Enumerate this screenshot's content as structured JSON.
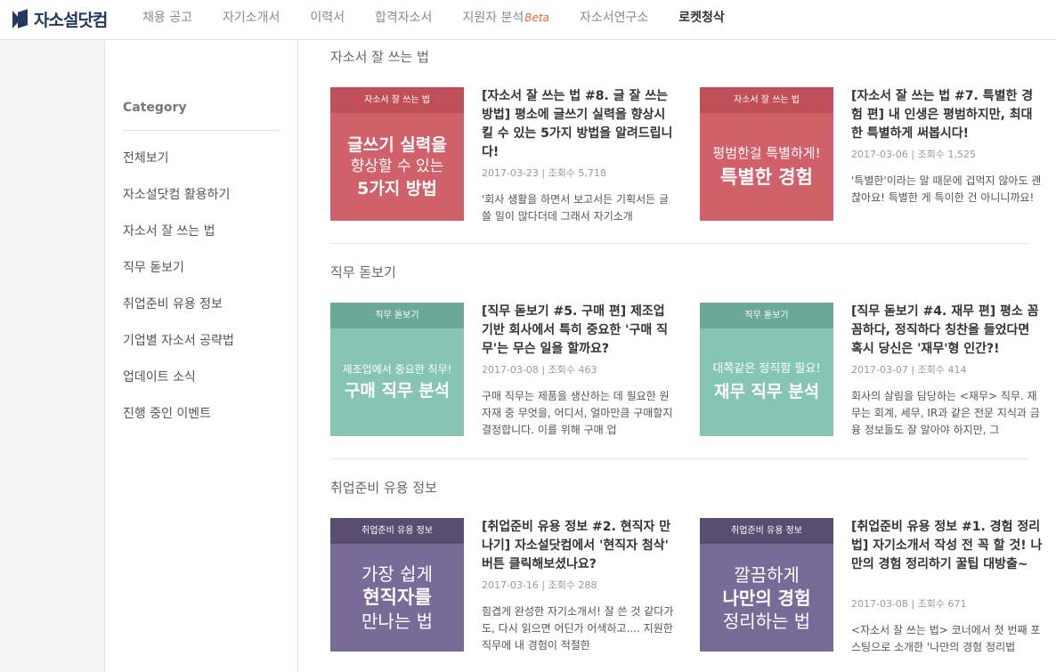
{
  "header": {
    "logo_text": "자소설닷컴",
    "nav": [
      {
        "label": "채용 공고"
      },
      {
        "label": "자기소개서"
      },
      {
        "label": "이력서"
      },
      {
        "label": "합격자소서"
      },
      {
        "label": "지원자 분석",
        "badge": "Beta"
      },
      {
        "label": "자소서연구소"
      },
      {
        "label": "로켓청삭"
      }
    ]
  },
  "sidebar": {
    "title": "Category",
    "items": [
      {
        "label": "전체보기"
      },
      {
        "label": "자소설닷컴 활용하기"
      },
      {
        "label": "자소서 잘 쓰는 법"
      },
      {
        "label": "직무 돋보기"
      },
      {
        "label": "취업준비 유용 정보"
      },
      {
        "label": "기업별 자소서 공략법"
      },
      {
        "label": "업데이트 소식"
      },
      {
        "label": "진행 중인 이벤트"
      }
    ]
  },
  "sections": [
    {
      "title": "자소서 잘 쓰는 법",
      "cards": [
        {
          "thumb_tag": "자소서 잘 쓰는 법",
          "thumb_lines": [
            "글쓰기 실력을",
            "향상할 수 있는",
            "5가지 방법"
          ],
          "title": "[자소서 잘 쓰는 법 #8. 글 잘 쓰는 방법] 평소에 글쓰기 실력을 향상시킬 수 있는 5가지 방법을 알려드립니다!",
          "meta": "2017-03-23 | 조회수 5,718",
          "desc": "'회사 생활을 하면서 보고서든 기획서든 글 쓸 일이 많다더데 그래서 자기소개"
        },
        {
          "thumb_tag": "자소서 잘 쓰는 법",
          "thumb_lines": [
            "평범한걸 특별하게!",
            "특별한 경험"
          ],
          "title": "[자소서 잘 쓰는 법 #7. 특별한 경험 편] 내 인생은 평범하지만, 최대한 특별하게 써봅시다!",
          "meta": "2017-03-06 | 조회수 1,525",
          "desc": "'특별한'이라는 말 때문에 겁먹지 않아도 괜찮아요! 특별한 게 특이한 건 아니니까요! 실패한 경험, 성취한 경험, 리더십"
        }
      ]
    },
    {
      "title": "직무 돋보기",
      "cards": [
        {
          "thumb_tag": "직무 돋보기",
          "thumb_lines": [
            "제조업에서 중요한 직무!",
            "구매 직무 분석"
          ],
          "title": "[직무 돋보기 #5. 구매 편] 제조업 기반 회사에서 특히 중요한 '구매 직무'는 무슨 일을 할까요?",
          "meta": "2017-03-08 | 조회수 463",
          "desc": "구매 직무는 제품을 생산하는 데 필요한 원자재 중 무엇을, 어디서, 얼마만큼 구매할지 결정합니다. 이를 위해 구매 업"
        },
        {
          "thumb_tag": "직무 돋보기",
          "thumb_lines": [
            "대쪽같은 정직함 필요!",
            "재무 직무 분석"
          ],
          "title": "[직무 돋보기 #4. 재무 편] 평소 꼼꼼하다, 정직하다 칭찬을 들었다면 혹시 당신은 '재무'형 인간?!",
          "meta": "2017-03-07 | 조회수 414",
          "desc": "회사의 살림을 담당하는 <재무> 직무. 재무는 회계, 세무, IR과 같은 전문 지식과 금융 정보들도 잘 알아야 하지만, 그"
        }
      ]
    },
    {
      "title": "취업준비 유용 정보",
      "cards": [
        {
          "thumb_tag": "취업준비 유용 정보",
          "thumb_lines": [
            "가장 쉽게",
            "현직자를",
            "만나는 법"
          ],
          "title": "[취업준비 유용 정보 #2. 현직자 만나기] 자소설닷컴에서 '현직자 첨삭' 버튼 클릭해보셨나요?",
          "meta": "2017-03-16 | 조회수 288",
          "desc": "힘겹게 완성한 자기소개서! 잘 쓴 것 같다가도, 다시 읽으면 어딘가 어색하고.... 지원한 직무에 내 경험이 적절한"
        },
        {
          "thumb_tag": "취업준비 유용 정보",
          "thumb_lines": [
            "깔끔하게",
            "나만의 경험",
            "정리하는 법"
          ],
          "title": "[취업준비 유용 정보 #1. 경험 정리법] 자기소개서 작성 전 꼭 할 것! 나만의 경험 정리하기 꿀팁 대방출~",
          "meta": "2017-03-08 | 조회수 671",
          "desc": "<자소서 잘 쓰는 법> 코너에서 첫 번째 포스팅으로 소개한 '나만의 경험 정리법"
        }
      ]
    }
  ],
  "colors": {
    "brand": "#23395d",
    "red_tag": "#c14f59",
    "red_body": "#d0606a",
    "teal_tag": "#6aa897",
    "teal_body": "#86c5b3",
    "purple_tag": "#5b4d72",
    "purple_body": "#7a6a98",
    "beta": "#e06a3b"
  }
}
